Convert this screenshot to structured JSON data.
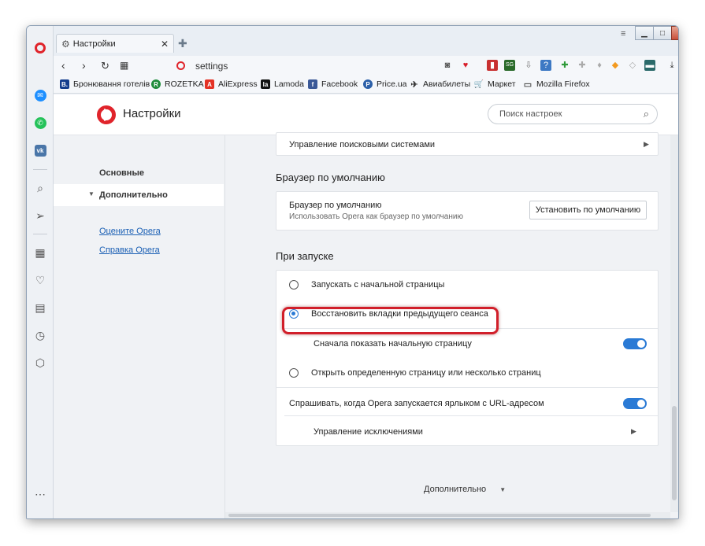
{
  "tab": {
    "title": "Настройки"
  },
  "address": {
    "url": "settings"
  },
  "bookmarks": [
    {
      "label": "Бронювання готелів",
      "color": "#123c8c",
      "glyph": "B."
    },
    {
      "label": "ROZETKA",
      "color": "#1f8c3b",
      "glyph": "R"
    },
    {
      "label": "AliExpress",
      "color": "#e43225",
      "glyph": "A"
    },
    {
      "label": "Lamoda",
      "color": "#111111",
      "glyph": "la"
    },
    {
      "label": "Facebook",
      "color": "#3b5998",
      "glyph": "f"
    },
    {
      "label": "Price.ua",
      "color": "#2b5fa8",
      "glyph": "P"
    },
    {
      "label": "Авиабилеты",
      "color": "#333333",
      "glyph": "✈"
    },
    {
      "label": "Маркет",
      "color": "#1f5fa8",
      "glyph": "🛒"
    },
    {
      "label": "Mozilla Firefox",
      "color": "#777777",
      "glyph": "▭"
    }
  ],
  "bookmarks_more": "»",
  "header": {
    "title": "Настройки",
    "search_placeholder": "Поиск настроек"
  },
  "nav": {
    "basic": "Основные",
    "advanced": "Дополнительно",
    "rate": "Оцените Opera",
    "help": "Справка Opera"
  },
  "search_engines": {
    "label": "Управление поисковыми системами"
  },
  "default_browser": {
    "section": "Браузер по умолчанию",
    "title": "Браузер по умолчанию",
    "subtitle": "Использовать Opera как браузер по умолчанию",
    "button": "Установить по умолчанию"
  },
  "startup": {
    "section": "При запуске",
    "option1": "Запускать с начальной страницы",
    "option2": "Восстановить вкладки предыдущего сеанса",
    "show_start": "Сначала показать начальную страницу",
    "option3": "Открыть определенную страницу или несколько страниц",
    "ask_url": "Спрашивать, когда Opera запускается ярлыком с URL-адресом",
    "exceptions": "Управление исключениями",
    "selected": "option2"
  },
  "footer": {
    "more": "Дополнительно"
  },
  "colors": {
    "accent": "#2a7ad5",
    "highlight": "#d11f2a",
    "opera_red": "#e0242b"
  }
}
